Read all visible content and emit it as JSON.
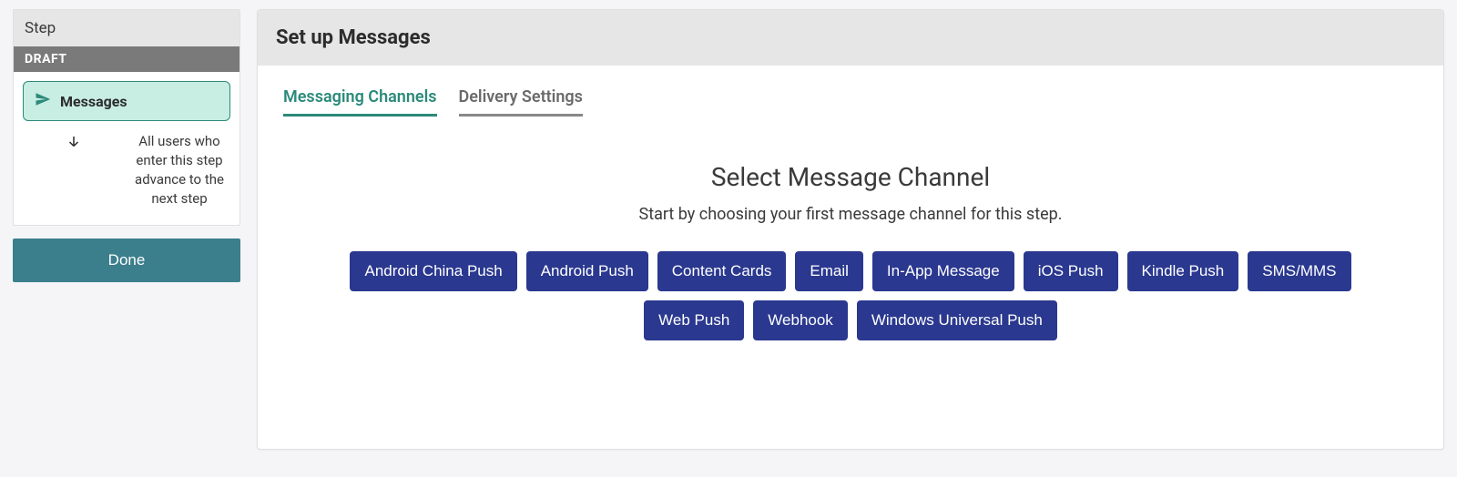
{
  "sidebar": {
    "step_header": "Step",
    "draft_label": "DRAFT",
    "messages_label": "Messages",
    "advance_note": "All users who enter this step advance to the next step",
    "done_label": "Done"
  },
  "panel": {
    "header_title": "Set up Messages",
    "tabs": {
      "channels": "Messaging Channels",
      "delivery": "Delivery Settings"
    },
    "channel_title": "Select Message Channel",
    "channel_subtitle": "Start by choosing your first message channel for this step.",
    "channels": {
      "android_china_push": "Android China Push",
      "android_push": "Android Push",
      "content_cards": "Content Cards",
      "email": "Email",
      "in_app_message": "In-App Message",
      "ios_push": "iOS Push",
      "kindle_push": "Kindle Push",
      "sms_mms": "SMS/MMS",
      "web_push": "Web Push",
      "webhook": "Webhook",
      "windows_universal_push": "Windows Universal Push"
    }
  }
}
